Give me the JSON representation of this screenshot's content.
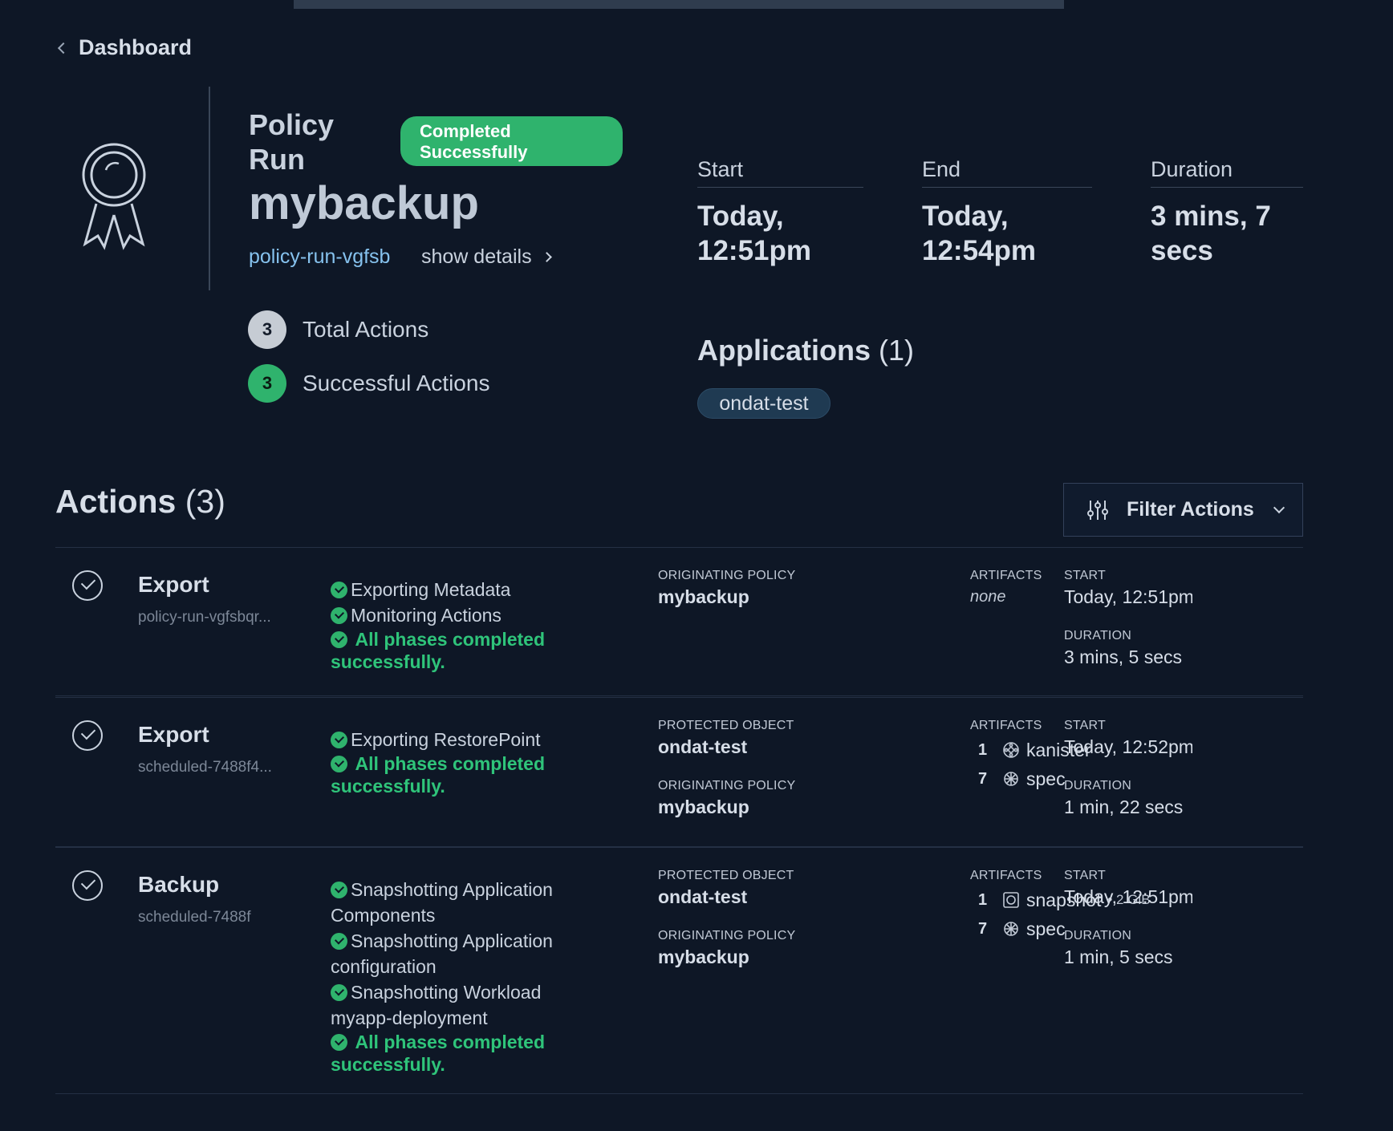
{
  "nav": {
    "back_label": "Dashboard"
  },
  "run": {
    "type_label": "Policy Run",
    "status": "Completed Successfully",
    "name": "mybackup",
    "id": "policy-run-vgfsb",
    "show_details": "show details",
    "total_actions_count": "3",
    "total_actions_label": "Total Actions",
    "successful_actions_count": "3",
    "successful_actions_label": "Successful Actions"
  },
  "meta": {
    "start_label": "Start",
    "start_value": "Today, 12:51pm",
    "end_label": "End",
    "end_value": "Today, 12:54pm",
    "duration_label": "Duration",
    "duration_value": "3 mins, 7 secs"
  },
  "applications": {
    "title": "Applications",
    "count": "(1)",
    "items": [
      "ondat-test"
    ]
  },
  "actions_section": {
    "title": "Actions",
    "count": "(3)",
    "filter_label": "Filter Actions"
  },
  "labels": {
    "originating_policy": "ORIGINATING POLICY",
    "protected_object": "PROTECTED OBJECT",
    "artifacts": "ARTIFACTS",
    "start": "START",
    "duration": "DURATION"
  },
  "actions": [
    {
      "name": "Export",
      "sub": "policy-run-vgfsbqr...",
      "phases": [
        "Exporting Metadata",
        "Monitoring Actions"
      ],
      "done": "All phases completed successfully.",
      "originating_policy": "mybackup",
      "artifacts_none": "none",
      "start": "Today, 12:51pm",
      "duration": "3 mins, 5 secs"
    },
    {
      "name": "Export",
      "sub": "scheduled-7488f4...",
      "phases": [
        "Exporting RestorePoint"
      ],
      "done": "All phases completed successfully.",
      "protected_object": "ondat-test",
      "originating_policy": "mybackup",
      "artifacts": [
        {
          "count": "1",
          "icon": "kanister-icon",
          "name": "kanister"
        },
        {
          "count": "7",
          "icon": "spec-icon",
          "name": "spec"
        }
      ],
      "start": "Today, 12:52pm",
      "duration": "1 min, 22 secs"
    },
    {
      "name": "Backup",
      "sub": "scheduled-7488f",
      "phases": [
        "Snapshotting Application Components",
        "Snapshotting Application configuration",
        "Snapshotting Workload myapp-deployment"
      ],
      "done": "All phases completed successfully.",
      "protected_object": "ondat-test",
      "originating_policy": "mybackup",
      "artifacts": [
        {
          "count": "1",
          "icon": "snapshot-icon",
          "name": "snapshot",
          "size": "• 2 GiB"
        },
        {
          "count": "7",
          "icon": "spec-icon",
          "name": "spec"
        }
      ],
      "start": "Today, 12:51pm",
      "duration": "1 min, 5 secs"
    }
  ],
  "colors": {
    "background": "#0e1726",
    "success": "#2fb36d",
    "link": "#86c2ee"
  }
}
